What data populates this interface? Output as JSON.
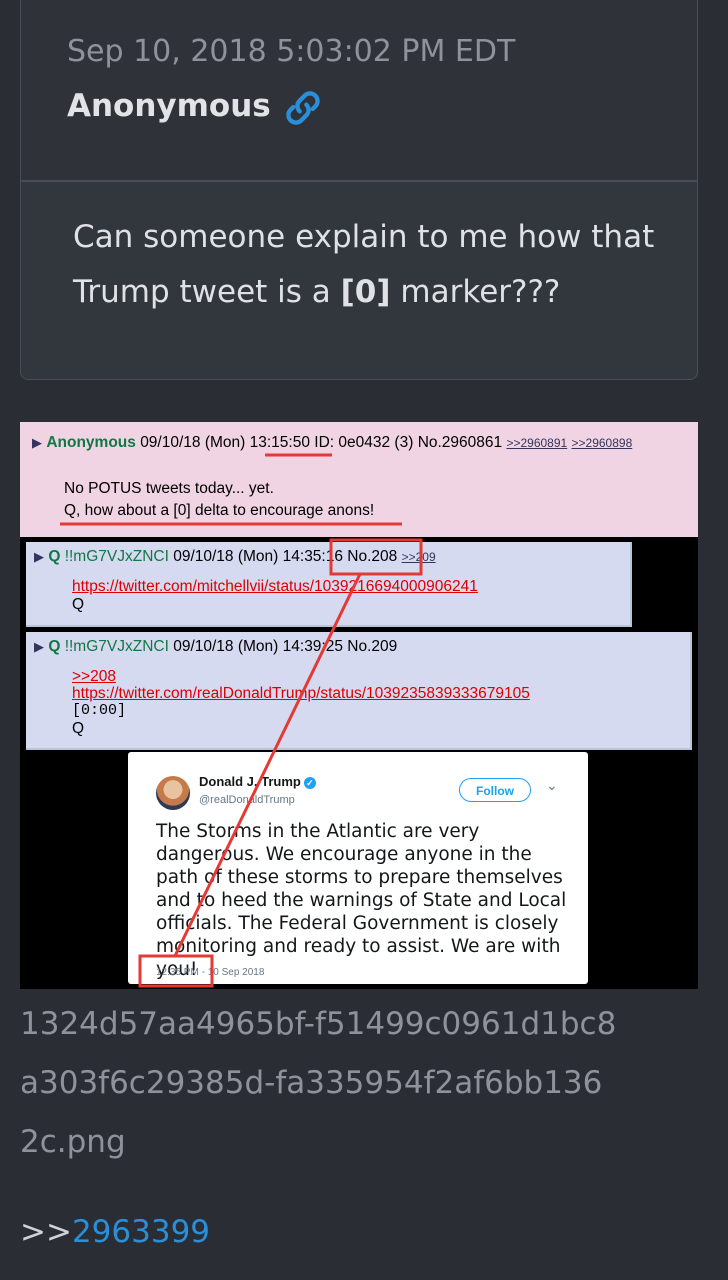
{
  "post": {
    "timestamp": "Sep 10, 2018 5:03:02 PM EDT",
    "author": "Anonymous",
    "link_icon": "link-icon",
    "body_before": "Can someone explain to me how that Trump tweet is a ",
    "body_bold": "[0]",
    "body_after": " marker???"
  },
  "screenshot": {
    "op": {
      "name": "Anonymous",
      "date": "09/10/18 (Mon)",
      "time": "13:15:50",
      "id_text": "ID: 0e0432 (3)",
      "number": "No.2960861",
      "backlink1": ">>2960891",
      "backlink2": ">>2960898",
      "line1": "No POTUS tweets today... yet.",
      "line2": "Q, how about a [0] delta to encourage anons!"
    },
    "reply1": {
      "name": "Q",
      "trip": "!!mG7VJxZNCI",
      "date": "09/10/18 (Mon)",
      "time": "14:35:16",
      "number": "No.208",
      "backlink": ">>209",
      "url": "https://twitter.com/mitchellvii/status/1039216694000906241",
      "sig": "Q"
    },
    "reply2": {
      "name": "Q",
      "trip": "!!mG7VJxZNCI",
      "date": "09/10/18 (Mon)",
      "time": "14:39:25",
      "number": "No.209",
      "quote": ">>208",
      "url": "https://twitter.com/realDonaldTrump/status/1039235839333679105",
      "marker": "[0:00]",
      "sig": "Q"
    },
    "tweet": {
      "name": "Donald J. Trump",
      "handle": "@realDonaldTrump",
      "follow_label": "Follow",
      "text": "The Storms in the Atlantic are very dangerous. We encourage anyone in the path of these storms to prepare themselves and to heed the warnings of State and Local officials. The Federal Government is closely monitoring and ready to assist. We are with you!",
      "time": "12:35 PM - 10 Sep 2018"
    },
    "highlight_color": "#e53935"
  },
  "filename": "1324d57aa4965bf-f51499c0961d1bc8a303f6c29385d-fa335954f2af6bb1362c.png",
  "reference": {
    "prefix": ">>",
    "number": "2963399"
  },
  "colors": {
    "background": "#2a2d33",
    "card": "#32363d",
    "link": "#2a8fd8"
  }
}
